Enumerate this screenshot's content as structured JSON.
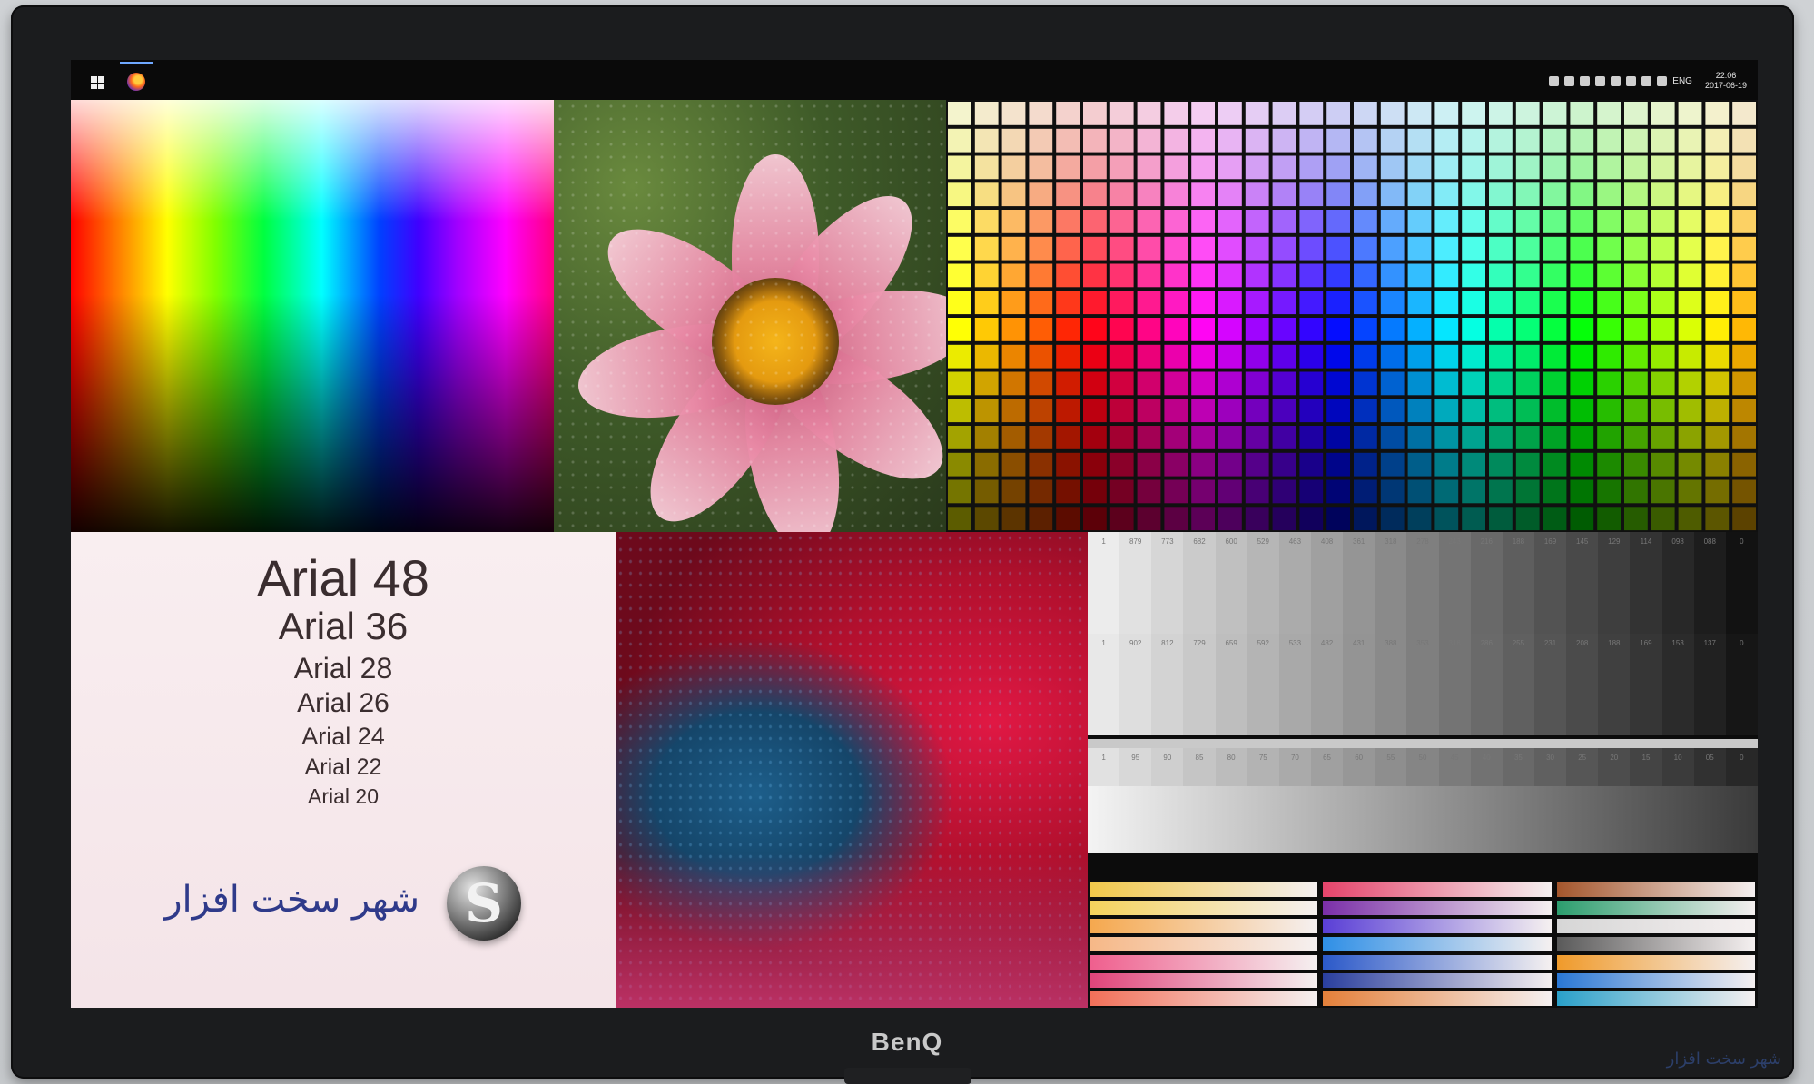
{
  "monitor": {
    "brand": "BenQ"
  },
  "watermark": "شهر سخت افزار",
  "taskbar": {
    "language": "ENG",
    "time": "22:06",
    "date": "2017-06-19",
    "tray_icons": [
      "network-icon",
      "chrome-icon",
      "update-icon",
      "messenger-icon",
      "usb-icon",
      "printer-icon",
      "monitor-icon",
      "volume-icon"
    ]
  },
  "font_samples": [
    "Arial 48",
    "Arial 36",
    "Arial 28",
    "Arial 26",
    "Arial 24",
    "Arial 22",
    "Arial 20"
  ],
  "logo": {
    "text": "شهر سخت افزار",
    "badge": "S"
  },
  "grayscale": {
    "row1": [
      "1",
      "879",
      "773",
      "682",
      "600",
      "529",
      "463",
      "408",
      "361",
      "318",
      "278",
      "243",
      "216",
      "188",
      "169",
      "145",
      "129",
      "114",
      "098",
      "088",
      "0"
    ],
    "row2": [
      "1",
      "902",
      "812",
      "729",
      "659",
      "592",
      "533",
      "482",
      "431",
      "388",
      "353",
      "318",
      "286",
      "255",
      "231",
      "208",
      "188",
      "169",
      "153",
      "137",
      "0"
    ],
    "row3": [
      "1",
      "95",
      "90",
      "85",
      "80",
      "75",
      "70",
      "65",
      "60",
      "55",
      "50",
      "45",
      "40",
      "35",
      "30",
      "25",
      "20",
      "15",
      "10",
      "05",
      "0"
    ]
  },
  "colors": {
    "bars_left": [
      "#f2c84a",
      "#f5d25c",
      "#f5a84e",
      "#f6b887",
      "#ef5f8e",
      "#e0447a",
      "#f27059"
    ],
    "bars_mid": [
      "#e5446b",
      "#7a2fa8",
      "#5a3fd6",
      "#2f8fe6",
      "#2b59c9",
      "#2a3f9e",
      "#e4803a"
    ],
    "bars_right": [
      "#a4562c",
      "#2c9e6e",
      "#d6d6d6",
      "#5a5a5a",
      "#f09a2a",
      "#2a78d6",
      "#2aa0c9"
    ]
  }
}
